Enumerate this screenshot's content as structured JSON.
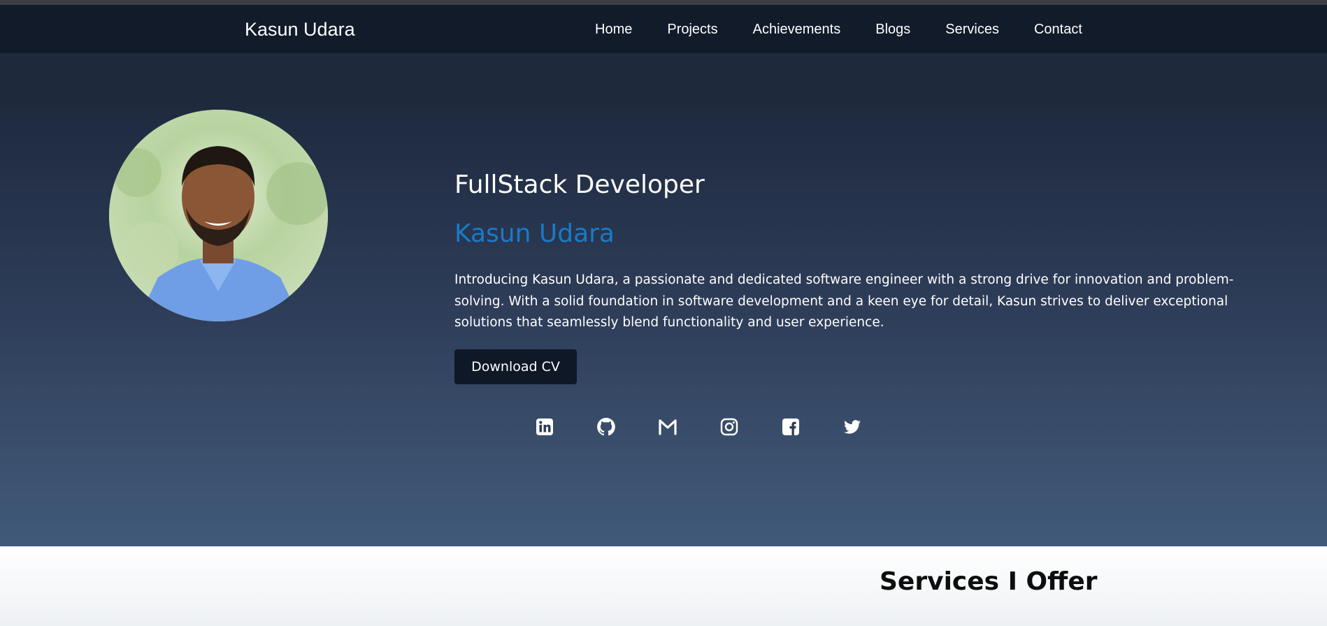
{
  "navbar": {
    "brand": "Kasun Udara",
    "links": [
      "Home",
      "Projects",
      "Achievements",
      "Blogs",
      "Services",
      "Contact"
    ]
  },
  "hero": {
    "subtitle": "FullStack Developer",
    "name": "Kasun Udara",
    "bio": "Introducing Kasun Udara, a passionate and dedicated software engineer with a strong drive for innovation and problem-solving. With a solid foundation in software development and a keen eye for detail, Kasun strives to deliver exceptional solutions that seamlessly blend functionality and user experience.",
    "cv_button": "Download CV",
    "avatar_alt": "profile-photo",
    "socials": [
      "linkedin-icon",
      "github-icon",
      "gmail-icon",
      "instagram-icon",
      "facebook-icon",
      "twitter-icon"
    ]
  },
  "services": {
    "title": "Services I Offer"
  },
  "colors": {
    "nav_bg": "#111b2a",
    "accent": "#1a7ac7",
    "button_bg": "#0e1827"
  }
}
